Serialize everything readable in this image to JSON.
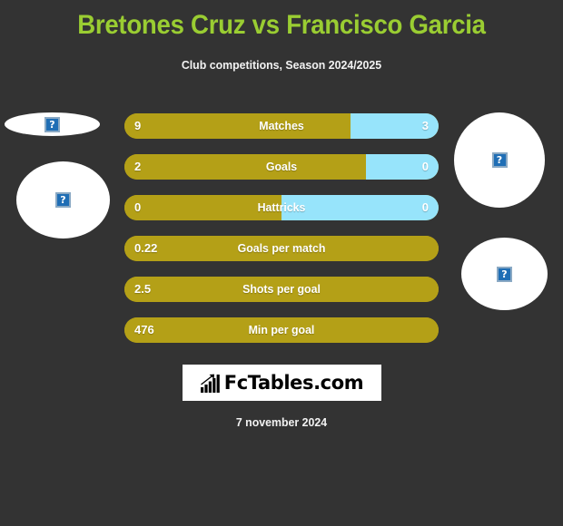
{
  "header": {
    "title": "Bretones Cruz vs Francisco Garcia",
    "subtitle": "Club competitions, Season 2024/2025"
  },
  "colors": {
    "background": "#333333",
    "title": "#9acd32",
    "home_bar": "#b4a017",
    "away_bar": "#97e4fb",
    "text": "#ffffff",
    "placeholder_icon": "#1f6eb5"
  },
  "photos": {
    "left_top": {
      "icon": "broken-image-icon",
      "glyph": "?"
    },
    "left_bottom": {
      "icon": "broken-image-icon",
      "glyph": "?"
    },
    "right_top": {
      "icon": "broken-image-icon",
      "glyph": "?"
    },
    "right_bottom": {
      "icon": "broken-image-icon",
      "glyph": "?"
    }
  },
  "stats": [
    {
      "label": "Matches",
      "home": "9",
      "away": "3",
      "home_pct": 72,
      "away_pct": 28
    },
    {
      "label": "Goals",
      "home": "2",
      "away": "0",
      "home_pct": 77,
      "away_pct": 23
    },
    {
      "label": "Hattricks",
      "home": "0",
      "away": "0",
      "home_pct": 50,
      "away_pct": 50
    },
    {
      "label": "Goals per match",
      "home": "0.22",
      "away": "",
      "home_pct": 100,
      "away_pct": 0
    },
    {
      "label": "Shots per goal",
      "home": "2.5",
      "away": "",
      "home_pct": 100,
      "away_pct": 0
    },
    {
      "label": "Min per goal",
      "home": "476",
      "away": "",
      "home_pct": 100,
      "away_pct": 0
    }
  ],
  "logo": {
    "text": "FcTables.com",
    "icon": "bar-chart-growth-icon"
  },
  "footer": {
    "date": "7 november 2024"
  }
}
